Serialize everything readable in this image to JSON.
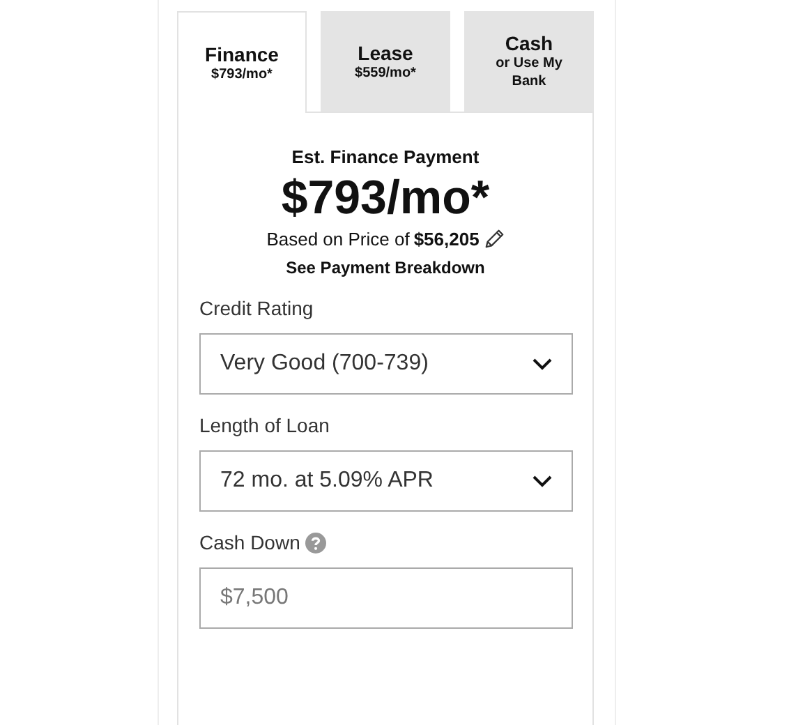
{
  "tabs": [
    {
      "title": "Finance",
      "subtitle": "$793/mo*",
      "selected": true
    },
    {
      "title": "Lease",
      "subtitle": "$559/mo*",
      "selected": false
    },
    {
      "title": "Cash",
      "subtitle": "or Use My Bank",
      "selected": false
    }
  ],
  "payment": {
    "heading": "Est. Finance Payment",
    "amount": "$793/mo*",
    "price_label": "Based on Price of",
    "price": "$56,205",
    "breakdown_link": "See Payment Breakdown"
  },
  "fields": [
    {
      "kind": "select",
      "label": "Credit Rating",
      "value": "Very Good (700-739)"
    },
    {
      "kind": "select",
      "label": "Length of Loan",
      "value": "72 mo. at 5.09% APR"
    },
    {
      "kind": "input",
      "label": "Cash Down",
      "help": true,
      "value": "$7,500"
    }
  ]
}
